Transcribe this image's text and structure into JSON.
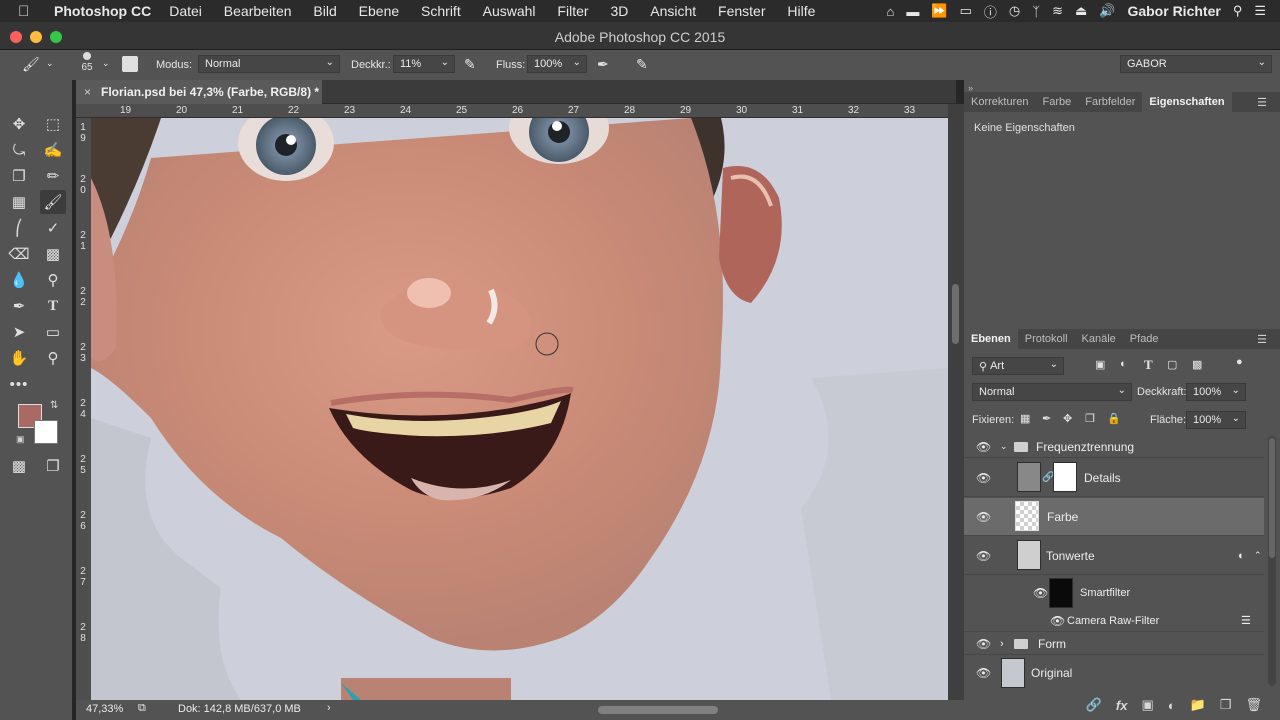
{
  "menubar": {
    "app": "Photoshop CC",
    "items": [
      "Datei",
      "Bearbeiten",
      "Bild",
      "Ebene",
      "Schrift",
      "Auswahl",
      "Filter",
      "3D",
      "Ansicht",
      "Fenster",
      "Hilfe"
    ],
    "user": "Gabor Richter"
  },
  "window": {
    "title": "Adobe Photoshop CC 2015"
  },
  "options": {
    "brush_size": "65",
    "modus_label": "Modus:",
    "modus_value": "Normal",
    "deckkr_label": "Deckkr.:",
    "deckkr_value": "11%",
    "fluss_label": "Fluss:",
    "fluss_value": "100%",
    "workspace": "GABOR"
  },
  "document": {
    "tab_title": "Florian.psd bei 47,3% (Farbe, RGB/8) *",
    "ruler_h": [
      "19",
      "20",
      "21",
      "22",
      "23",
      "24",
      "25",
      "26",
      "27",
      "28",
      "29",
      "30",
      "31",
      "32",
      "33"
    ],
    "ruler_v": [
      [
        "1",
        "9"
      ],
      [
        "2",
        "0"
      ],
      [
        "2",
        "1"
      ],
      [
        "2",
        "2"
      ],
      [
        "2",
        "3"
      ],
      [
        "2",
        "4"
      ],
      [
        "2",
        "5"
      ],
      [
        "2",
        "6"
      ],
      [
        "2",
        "7"
      ],
      [
        "2",
        "8"
      ]
    ]
  },
  "status": {
    "zoom": "47,33%",
    "doc": "Dok: 142,8 MB/637,0 MB"
  },
  "colors": {
    "foreground": "#a86a62",
    "background": "#ffffff"
  },
  "props_panel": {
    "tabs": [
      "Korrekturen",
      "Farbe",
      "Farbfelder",
      "Eigenschaften"
    ],
    "active": "Eigenschaften",
    "empty_text": "Keine Eigenschaften"
  },
  "layers_panel": {
    "tabs": [
      "Ebenen",
      "Protokoll",
      "Kanäle",
      "Pfade"
    ],
    "filter_value": "Art",
    "blend_mode": "Normal",
    "opacity_label": "Deckkraft:",
    "opacity_value": "100%",
    "lock_label": "Fixieren:",
    "fill_label": "Fläche:",
    "fill_value": "100%",
    "layers": [
      {
        "name": "Frequenztrennung"
      },
      {
        "name": "Details"
      },
      {
        "name": "Farbe"
      },
      {
        "name": "Tonwerte"
      },
      {
        "name": "Smartfilter"
      },
      {
        "name": "Camera Raw-Filter"
      },
      {
        "name": "Form"
      },
      {
        "name": "Original"
      }
    ]
  }
}
